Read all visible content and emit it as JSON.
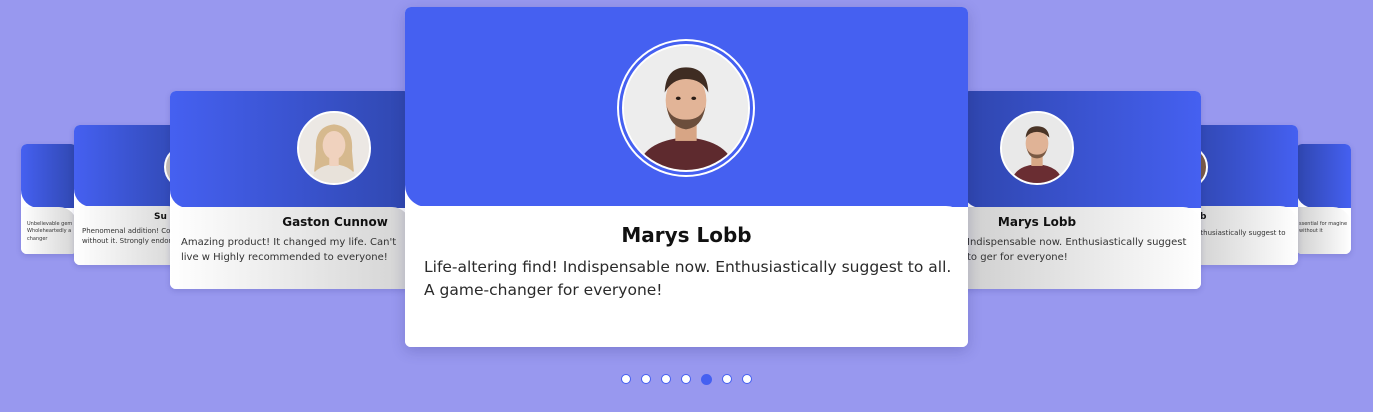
{
  "carousel": {
    "active_index": 4,
    "dot_count": 7,
    "accent_color": "#4560f1",
    "background_color": "#9898ef"
  },
  "cards": {
    "far_left": {
      "text": "Unbelievable gem Wholeheartedly a changer"
    },
    "near_left": {
      "name": "Su",
      "text": "Phenomenal addition! Com without it. Strongly endors"
    },
    "left": {
      "name": "Gaston Cunnow",
      "text": "Amazing product! It changed my life. Can't live w Highly recommended to everyone!",
      "avatar": "woman-portrait"
    },
    "center": {
      "name": "Marys Lobb",
      "text": "Life-altering find! Indispensable now. Enthusiastically suggest to all. A game-changer for everyone!",
      "avatar": "man-portrait"
    },
    "right": {
      "name": "Marys Lobb",
      "text": "Indispensable now. Enthusiastically suggest to ger for everyone!",
      "avatar": "man-portrait"
    },
    "near_right": {
      "name": "b",
      "text": "nthusiastically suggest to"
    },
    "far_right": {
      "text": "ssential for magine without it"
    }
  }
}
